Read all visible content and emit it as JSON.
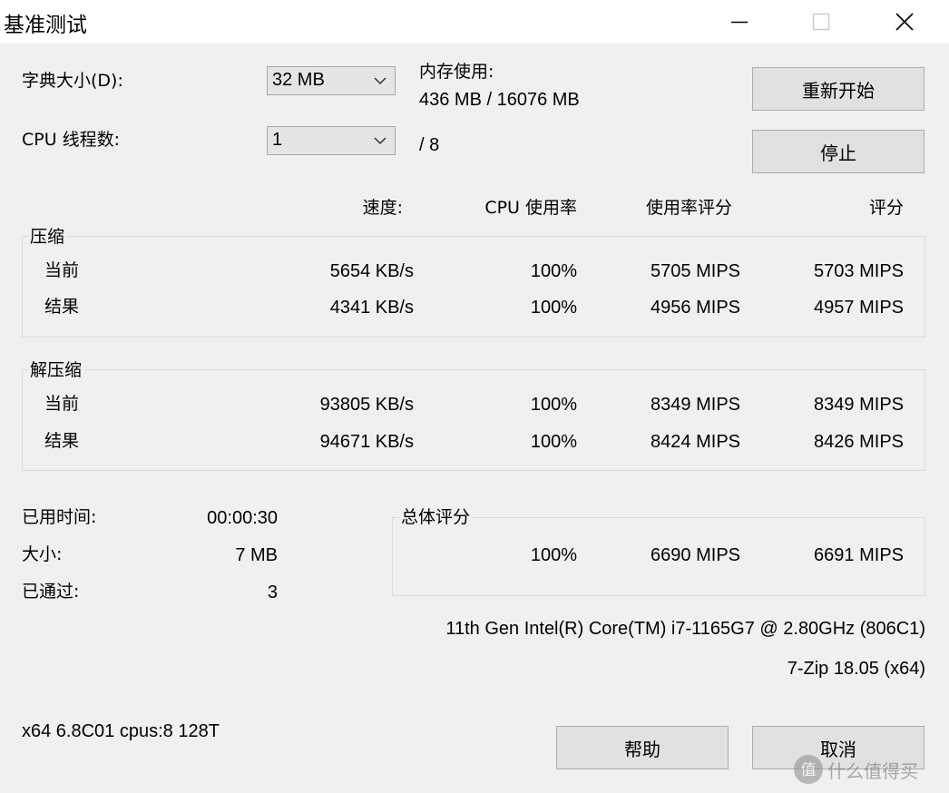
{
  "window": {
    "title": "基准测试"
  },
  "dictionary": {
    "label": "字典大小(D):",
    "value": "32 MB"
  },
  "threads": {
    "label": "CPU 线程数:",
    "value": "1",
    "total": "/ 8"
  },
  "memory": {
    "label": "内存使用:",
    "value": "436 MB / 16076 MB"
  },
  "buttons": {
    "restart": "重新开始",
    "stop": "停止",
    "help": "帮助",
    "cancel": "取消"
  },
  "columns": {
    "speed": "速度:",
    "cpu_usage": "CPU 使用率",
    "usage_rating": "使用率评分",
    "rating": "评分"
  },
  "compress": {
    "title": "压缩",
    "rows": [
      {
        "label": "当前",
        "speed": "5654 KB/s",
        "usage": "100%",
        "usage_rating": "5705 MIPS",
        "rating": "5703 MIPS"
      },
      {
        "label": "结果",
        "speed": "4341 KB/s",
        "usage": "100%",
        "usage_rating": "4956 MIPS",
        "rating": "4957 MIPS"
      }
    ]
  },
  "decompress": {
    "title": "解压缩",
    "rows": [
      {
        "label": "当前",
        "speed": "93805 KB/s",
        "usage": "100%",
        "usage_rating": "8349 MIPS",
        "rating": "8349 MIPS"
      },
      {
        "label": "结果",
        "speed": "94671 KB/s",
        "usage": "100%",
        "usage_rating": "8424 MIPS",
        "rating": "8426 MIPS"
      }
    ]
  },
  "stats": {
    "elapsed_label": "已用时间:",
    "elapsed": "00:00:30",
    "size_label": "大小:",
    "size": "7 MB",
    "passes_label": "已通过:",
    "passes": "3"
  },
  "total": {
    "title": "总体评分",
    "usage": "100%",
    "usage_rating": "6690 MIPS",
    "rating": "6691 MIPS"
  },
  "cpu_name": "11th Gen Intel(R) Core(TM) i7-1165G7 @ 2.80GHz (806C1)",
  "version": "7-Zip 18.05 (x64)",
  "sysinfo": "x64 6.8C01 cpus:8 128T",
  "watermark": "什么值得买"
}
